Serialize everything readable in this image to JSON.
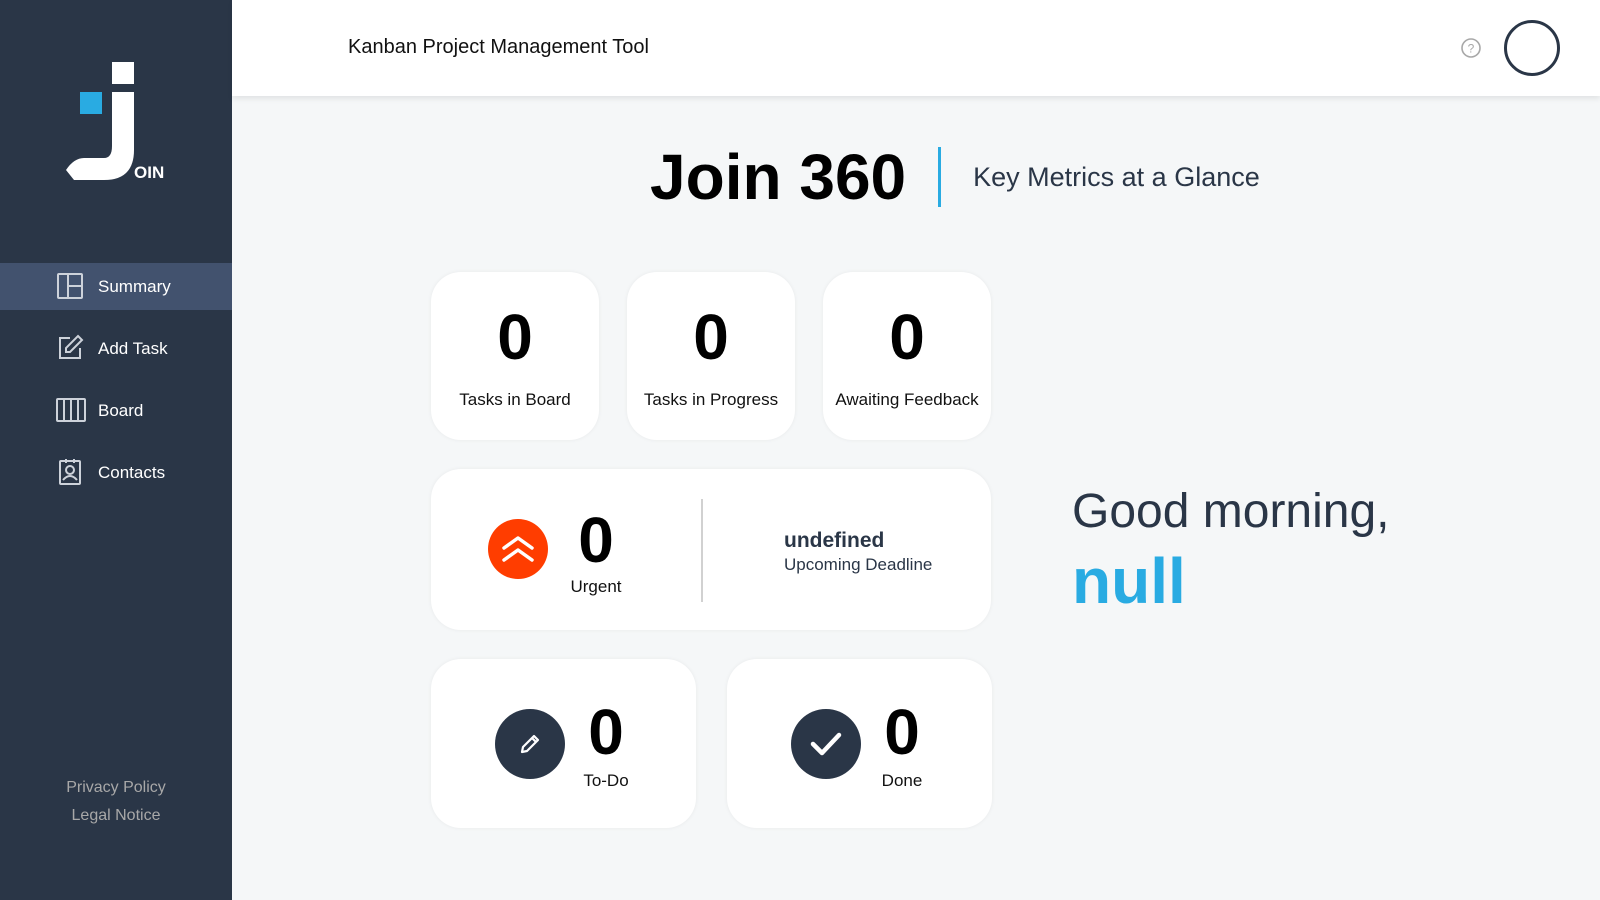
{
  "app": {
    "logo_text": "OIN",
    "header_title": "Kanban Project Management Tool"
  },
  "sidebar": {
    "items": [
      {
        "label": "Summary",
        "icon": "summary-icon",
        "active": true
      },
      {
        "label": "Add Task",
        "icon": "add-task-icon",
        "active": false
      },
      {
        "label": "Board",
        "icon": "board-icon",
        "active": false
      },
      {
        "label": "Contacts",
        "icon": "contacts-icon",
        "active": false
      }
    ],
    "footer": {
      "privacy": "Privacy Policy",
      "legal": "Legal Notice"
    }
  },
  "heading": {
    "title": "Join 360",
    "subtitle": "Key Metrics at a Glance"
  },
  "metrics": {
    "tasks_in_board": {
      "value": "0",
      "label": "Tasks in Board"
    },
    "tasks_in_progress": {
      "value": "0",
      "label": "Tasks in Progress"
    },
    "awaiting_feedback": {
      "value": "0",
      "label": "Awaiting Feedback"
    },
    "urgent": {
      "value": "0",
      "label": "Urgent"
    },
    "deadline": {
      "date": "undefined",
      "label": "Upcoming Deadline"
    },
    "todo": {
      "value": "0",
      "label": "To-Do"
    },
    "done": {
      "value": "0",
      "label": "Done"
    }
  },
  "greeting": {
    "text": "Good morning,",
    "name": "null"
  },
  "colors": {
    "sidebar_bg": "#2a3647",
    "accent": "#29abe2",
    "urgent": "#ff3d00",
    "active_nav": "#42526e"
  }
}
